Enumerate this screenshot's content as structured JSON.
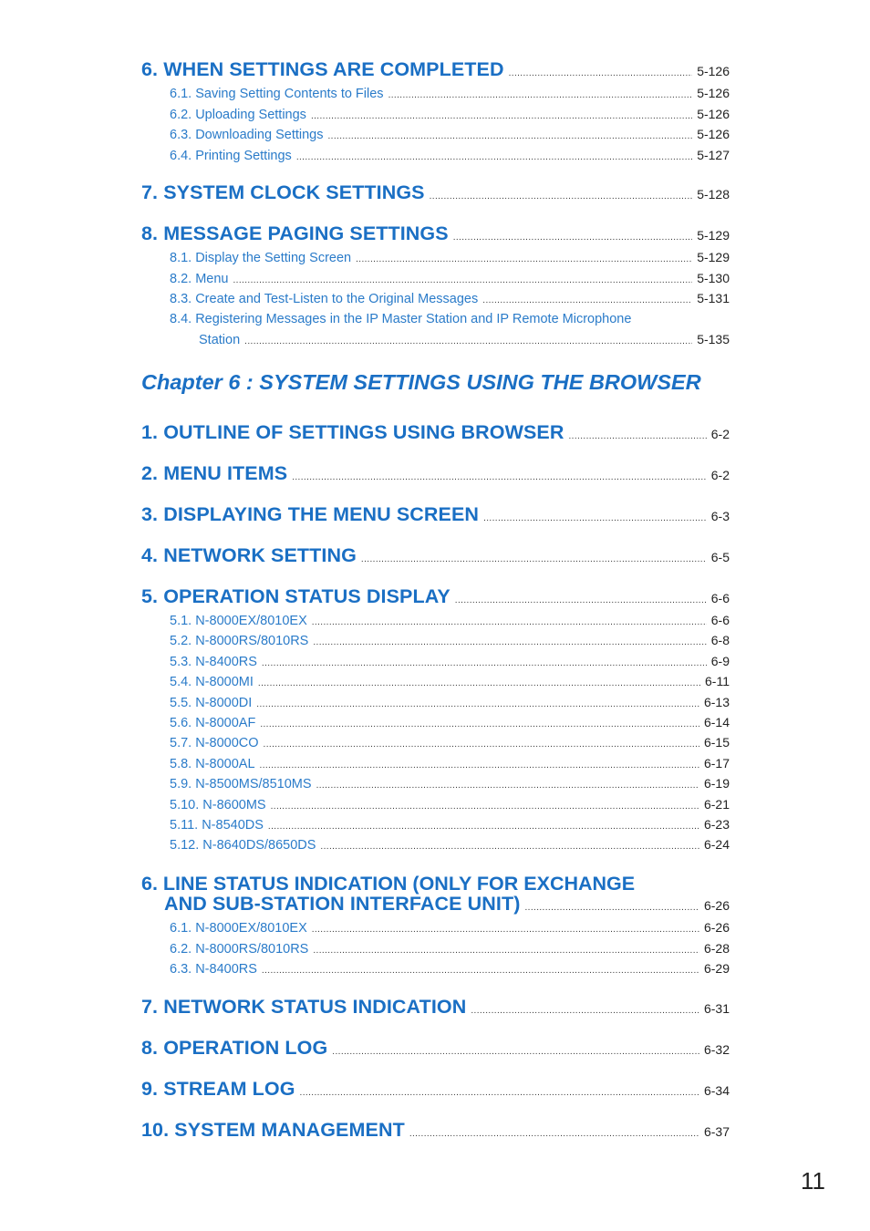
{
  "page_number": "11",
  "colors": {
    "heading": "#1a6fc4",
    "subheading": "#2a7bc9",
    "text": "#222222"
  },
  "ch5": {
    "s6": {
      "title": "6. WHEN SETTINGS ARE COMPLETED",
      "page": "5-126",
      "items": [
        {
          "title": "6.1. Saving Setting Contents to Files",
          "page": "5-126"
        },
        {
          "title": "6.2. Uploading Settings",
          "page": "5-126"
        },
        {
          "title": "6.3. Downloading Settings",
          "page": "5-126"
        },
        {
          "title": "6.4. Printing Settings",
          "page": "5-127"
        }
      ]
    },
    "s7": {
      "title": "7. SYSTEM CLOCK SETTINGS",
      "page": "5-128"
    },
    "s8": {
      "title": "8. MESSAGE PAGING SETTINGS",
      "page": "5-129",
      "items": [
        {
          "title": "8.1. Display the Setting Screen",
          "page": "5-129"
        },
        {
          "title": "8.2. Menu",
          "page": "5-130"
        },
        {
          "title": "8.3. Create and Test-Listen to the Original Messages",
          "page": "5-131"
        },
        {
          "title": "8.4. Registering Messages in the IP Master Station and IP Remote Microphone",
          "cont": "Station",
          "page": "5-135"
        }
      ]
    }
  },
  "ch6": {
    "chapter_title": "Chapter 6 : SYSTEM SETTINGS USING THE BROWSER",
    "s1": {
      "title": "1. OUTLINE OF SETTINGS USING BROWSER",
      "page": "6-2"
    },
    "s2": {
      "title": "2. MENU ITEMS",
      "page": "6-2"
    },
    "s3": {
      "title": "3. DISPLAYING THE MENU SCREEN",
      "page": "6-3"
    },
    "s4": {
      "title": "4. NETWORK SETTING",
      "page": "6-5"
    },
    "s5": {
      "title": "5. OPERATION STATUS DISPLAY",
      "page": "6-6",
      "items": [
        {
          "title": "5.1. N-8000EX/8010EX",
          "page": "6-6"
        },
        {
          "title": "5.2. N-8000RS/8010RS",
          "page": "6-8"
        },
        {
          "title": "5.3. N-8400RS",
          "page": "6-9"
        },
        {
          "title": "5.4. N-8000MI",
          "page": "6-11"
        },
        {
          "title": "5.5. N-8000DI",
          "page": "6-13"
        },
        {
          "title": "5.6. N-8000AF",
          "page": "6-14"
        },
        {
          "title": "5.7. N-8000CO",
          "page": "6-15"
        },
        {
          "title": "5.8. N-8000AL",
          "page": "6-17"
        },
        {
          "title": "5.9. N-8500MS/8510MS",
          "page": "6-19"
        },
        {
          "title": "5.10. N-8600MS",
          "page": "6-21"
        },
        {
          "title": "5.11. N-8540DS",
          "page": "6-23"
        },
        {
          "title": "5.12. N-8640DS/8650DS",
          "page": "6-24"
        }
      ]
    },
    "s6": {
      "title_line1": "6. LINE STATUS INDICATION (ONLY FOR EXCHANGE",
      "title_line2": "AND SUB-STATION INTERFACE UNIT)",
      "page": "6-26",
      "items": [
        {
          "title": "6.1. N-8000EX/8010EX",
          "page": "6-26"
        },
        {
          "title": "6.2. N-8000RS/8010RS",
          "page": "6-28"
        },
        {
          "title": "6.3. N-8400RS",
          "page": "6-29"
        }
      ]
    },
    "s7": {
      "title": "7. NETWORK STATUS INDICATION",
      "page": "6-31"
    },
    "s8": {
      "title": "8. OPERATION LOG",
      "page": "6-32"
    },
    "s9": {
      "title": "9. STREAM LOG",
      "page": "6-34"
    },
    "s10": {
      "title": "10. SYSTEM MANAGEMENT",
      "page": "6-37"
    }
  }
}
